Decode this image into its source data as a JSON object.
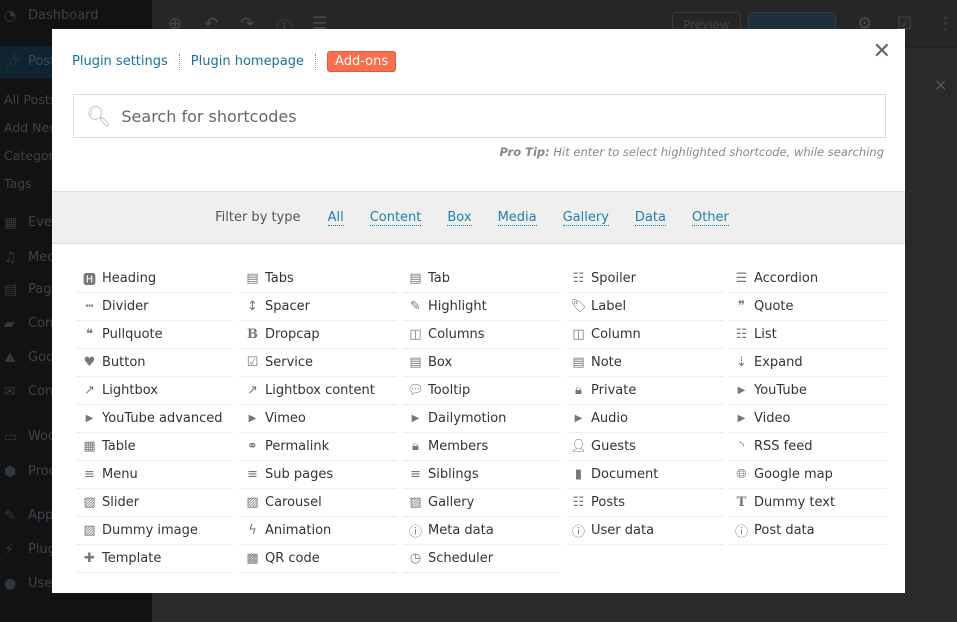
{
  "background": {
    "sidebar": [
      {
        "label": "Dashboard",
        "icon": "dashboard-icon"
      },
      {
        "label": "Posts",
        "icon": "pin-icon",
        "active": true
      },
      {
        "label": "All Posts",
        "sub": true
      },
      {
        "label": "Add New",
        "sub": true
      },
      {
        "label": "Categories",
        "sub": true
      },
      {
        "label": "Tags",
        "sub": true
      },
      {
        "label": "Events",
        "icon": "calendar-icon"
      },
      {
        "label": "Media",
        "icon": "media-icon"
      },
      {
        "label": "Pages",
        "icon": "pages-icon"
      },
      {
        "label": "Comments",
        "icon": "comment-icon"
      },
      {
        "label": "Goo",
        "icon": "map-icon"
      },
      {
        "label": "Con",
        "icon": "mail-icon"
      },
      {
        "label": "WooCommerce",
        "icon": "woo-icon"
      },
      {
        "label": "Products",
        "icon": "box-icon"
      },
      {
        "label": "Appearance",
        "icon": "brush-icon"
      },
      {
        "label": "Plugins",
        "icon": "plug-icon"
      },
      {
        "label": "Users",
        "icon": "user-icon"
      }
    ],
    "topbar": {
      "preview": "Preview",
      "save": "Save Draft"
    }
  },
  "modal": {
    "links": {
      "settings": "Plugin settings",
      "homepage": "Plugin homepage",
      "addons": "Add-ons"
    },
    "accent": "#f96e4c",
    "search_placeholder": "Search for shortcodes",
    "protip_label": "Pro Tip:",
    "protip_text": "Hit enter to select highlighted shortcode, while searching",
    "filter": {
      "label": "Filter by type",
      "options": [
        "All",
        "Content",
        "Box",
        "Media",
        "Gallery",
        "Data",
        "Other"
      ]
    },
    "shortcodes": [
      {
        "label": "Heading",
        "icon": "h"
      },
      {
        "label": "Tabs",
        "icon": "list-alt"
      },
      {
        "label": "Tab",
        "icon": "list-alt"
      },
      {
        "label": "Spoiler",
        "icon": "list-ul"
      },
      {
        "label": "Accordion",
        "icon": "list"
      },
      {
        "label": "Divider",
        "icon": "ellipsis"
      },
      {
        "label": "Spacer",
        "icon": "arrows-v"
      },
      {
        "label": "Highlight",
        "icon": "pencil"
      },
      {
        "label": "Label",
        "icon": "tag"
      },
      {
        "label": "Quote",
        "icon": "quote-right"
      },
      {
        "label": "Pullquote",
        "icon": "quote-left"
      },
      {
        "label": "Dropcap",
        "icon": "bold"
      },
      {
        "label": "Columns",
        "icon": "columns"
      },
      {
        "label": "Column",
        "icon": "columns"
      },
      {
        "label": "List",
        "icon": "list-ol"
      },
      {
        "label": "Button",
        "icon": "heart"
      },
      {
        "label": "Service",
        "icon": "check-square"
      },
      {
        "label": "Box",
        "icon": "list-alt"
      },
      {
        "label": "Note",
        "icon": "list-alt"
      },
      {
        "label": "Expand",
        "icon": "sort-amount"
      },
      {
        "label": "Lightbox",
        "icon": "external-link"
      },
      {
        "label": "Lightbox content",
        "icon": "external-link"
      },
      {
        "label": "Tooltip",
        "icon": "comment"
      },
      {
        "label": "Private",
        "icon": "lock"
      },
      {
        "label": "YouTube",
        "icon": "youtube"
      },
      {
        "label": "YouTube advanced",
        "icon": "youtube"
      },
      {
        "label": "Vimeo",
        "icon": "youtube"
      },
      {
        "label": "Dailymotion",
        "icon": "youtube"
      },
      {
        "label": "Audio",
        "icon": "play-circle"
      },
      {
        "label": "Video",
        "icon": "play-circle"
      },
      {
        "label": "Table",
        "icon": "table"
      },
      {
        "label": "Permalink",
        "icon": "link"
      },
      {
        "label": "Members",
        "icon": "lock"
      },
      {
        "label": "Guests",
        "icon": "user"
      },
      {
        "label": "RSS feed",
        "icon": "rss"
      },
      {
        "label": "Menu",
        "icon": "bars"
      },
      {
        "label": "Sub pages",
        "icon": "bars"
      },
      {
        "label": "Siblings",
        "icon": "bars"
      },
      {
        "label": "Document",
        "icon": "file"
      },
      {
        "label": "Google map",
        "icon": "globe"
      },
      {
        "label": "Slider",
        "icon": "picture"
      },
      {
        "label": "Carousel",
        "icon": "picture"
      },
      {
        "label": "Gallery",
        "icon": "picture"
      },
      {
        "label": "Posts",
        "icon": "th-list"
      },
      {
        "label": "Dummy text",
        "icon": "text-height"
      },
      {
        "label": "Dummy image",
        "icon": "picture"
      },
      {
        "label": "Animation",
        "icon": "bolt"
      },
      {
        "label": "Meta data",
        "icon": "info-circle"
      },
      {
        "label": "User data",
        "icon": "info-circle"
      },
      {
        "label": "Post data",
        "icon": "info-circle"
      },
      {
        "label": "Template",
        "icon": "puzzle"
      },
      {
        "label": "QR code",
        "icon": "qrcode"
      },
      {
        "label": "Scheduler",
        "icon": "clock"
      }
    ]
  }
}
